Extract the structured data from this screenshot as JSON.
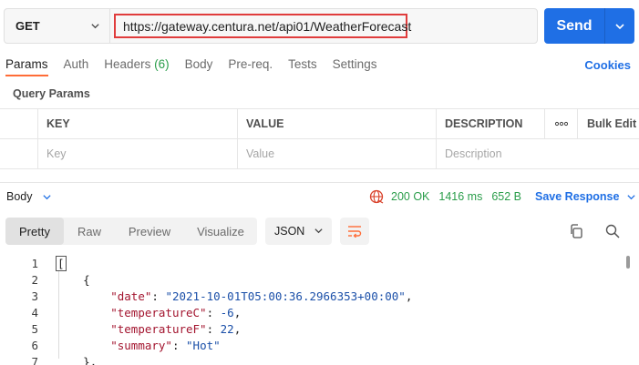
{
  "request": {
    "method": "GET",
    "url": "https://gateway.centura.net/api01/WeatherForecast",
    "send_label": "Send"
  },
  "tabs": [
    {
      "label": "Params",
      "active": true
    },
    {
      "label": "Auth"
    },
    {
      "label": "Headers",
      "count": "(6)"
    },
    {
      "label": "Body"
    },
    {
      "label": "Pre-req."
    },
    {
      "label": "Tests"
    },
    {
      "label": "Settings"
    }
  ],
  "cookies_label": "Cookies",
  "query_params": {
    "title": "Query Params",
    "headers": {
      "key": "KEY",
      "value": "VALUE",
      "description": "DESCRIPTION",
      "more": "ooo",
      "bulk_edit": "Bulk Edit"
    },
    "placeholders": {
      "key": "Key",
      "value": "Value",
      "description": "Description"
    }
  },
  "response": {
    "body_label": "Body",
    "status": "200 OK",
    "time": "1416 ms",
    "size": "652 B",
    "save_label": "Save Response",
    "views": [
      "Pretty",
      "Raw",
      "Preview",
      "Visualize"
    ],
    "active_view": "Pretty",
    "format": "JSON"
  },
  "code_lines": {
    "l1": "[",
    "l2": "{",
    "date_key": "\"date\"",
    "date_val": "\"2021-10-01T05:00:36.2966353+00:00\"",
    "tc_key": "\"temperatureC\"",
    "tc_val": "-6",
    "tf_key": "\"temperatureF\"",
    "tf_val": "22",
    "sum_key": "\"summary\"",
    "sum_val": "\"Hot\"",
    "l7": "},"
  },
  "line_numbers": [
    "1",
    "2",
    "3",
    "4",
    "5",
    "6",
    "7"
  ],
  "colors": {
    "accent": "#ff6c37",
    "send": "#1f6fe5",
    "status_ok": "#2a9d4a",
    "json_key": "#a3152f",
    "json_value": "#1a4fa8",
    "url_highlight": "#e03c3c"
  }
}
